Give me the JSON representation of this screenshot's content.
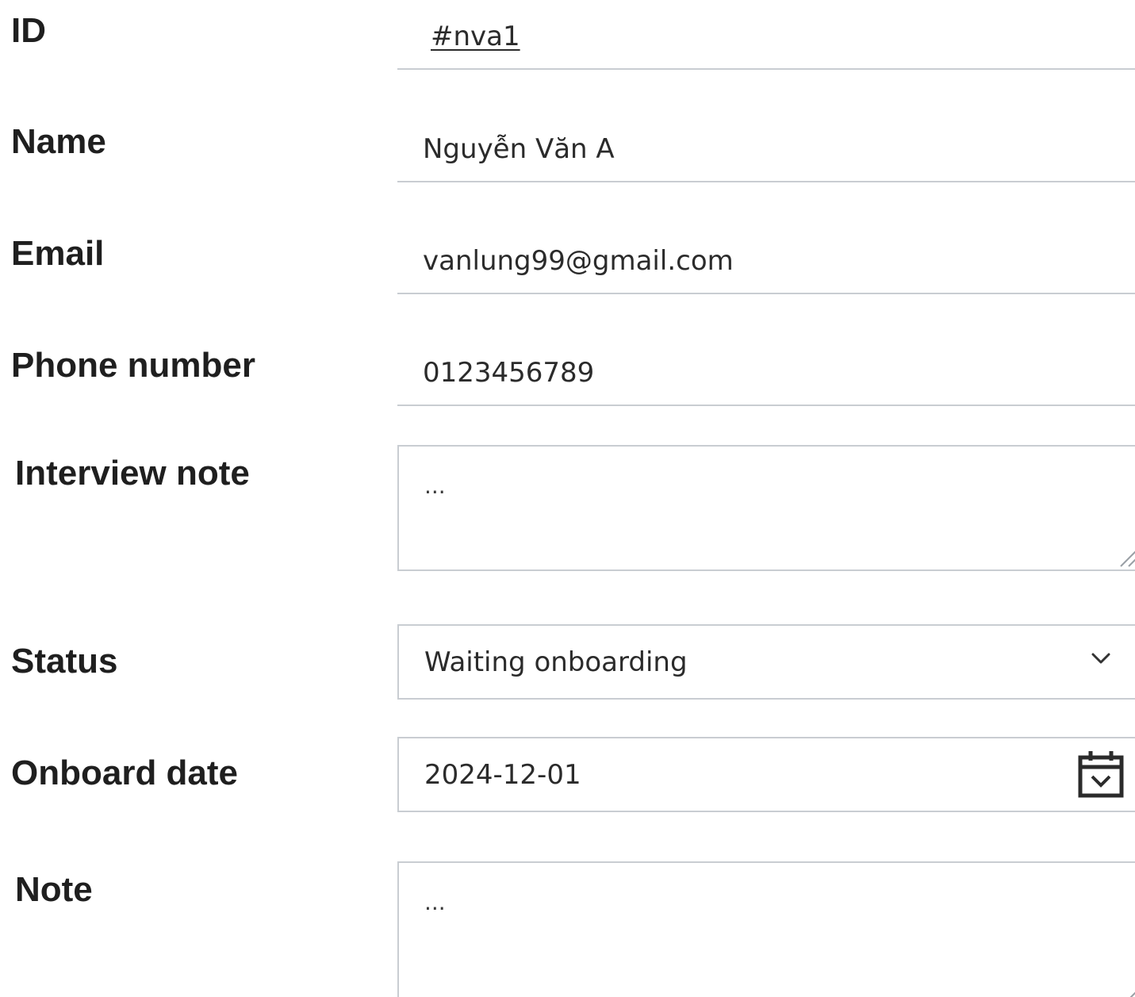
{
  "form": {
    "id": {
      "label": "ID",
      "value": "#nva1"
    },
    "name": {
      "label": "Name",
      "value": "Nguyễn Văn A"
    },
    "email": {
      "label": "Email",
      "value": "vanlung99@gmail.com"
    },
    "phone": {
      "label": "Phone number",
      "value": "0123456789"
    },
    "interview_note": {
      "label": "Interview note",
      "value": "..."
    },
    "status": {
      "label": "Status",
      "value": "Waiting onboarding"
    },
    "onboard_date": {
      "label": "Onboard date",
      "value": "2024-12-01"
    },
    "note": {
      "label": "Note",
      "value": "..."
    }
  },
  "icons": {
    "status_dropdown": "chevron-down-icon",
    "onboard_date_picker": "calendar-icon",
    "textarea_resize": "resize-grip-icon"
  },
  "colors": {
    "border": "#c9cdd2",
    "text": "#2b2b2b",
    "label": "#1f1f1f"
  }
}
